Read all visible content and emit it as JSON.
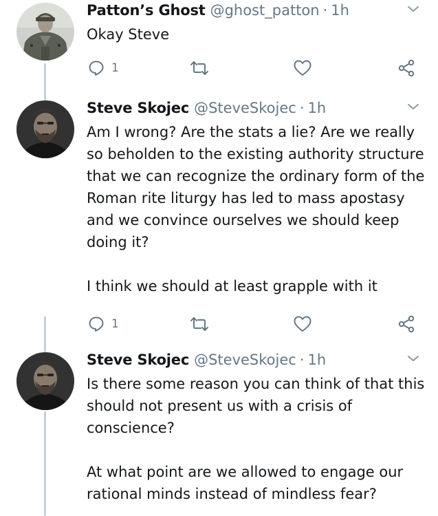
{
  "tweets": [
    {
      "display_name": "Patton’s Ghost",
      "handle": "@ghost_patton",
      "time": "1h",
      "paragraphs": [
        "Okay Steve"
      ],
      "reply_count": "1",
      "avatar_icon": "soldier-photo"
    },
    {
      "display_name": "Steve Skojec",
      "handle": "@SteveSkojec",
      "time": "1h",
      "paragraphs": [
        "Am I wrong? Are the stats a lie? Are we really so beholden to the existing authority structure that we can recognize the ordinary form of the Roman rite liturgy has led to mass apostasy and we convince ourselves we should keep doing it?",
        "I think we should at least grapple with it"
      ],
      "reply_count": "1",
      "avatar_icon": "bearded-man-photo"
    },
    {
      "display_name": "Steve Skojec",
      "handle": "@SteveSkojec",
      "time": "1h",
      "paragraphs": [
        "Is there some reason you can think of that this should not present us with a crisis of conscience?",
        "At what point are we allowed to engage our rational minds instead of mindless fear?"
      ],
      "avatar_icon": "bearded-man-photo"
    }
  ],
  "separator": "·",
  "icons": {
    "reply": "reply-icon",
    "retweet": "retweet-icon",
    "like": "heart-icon",
    "share": "share-icon",
    "more": "chevron-down-icon"
  },
  "colors": {
    "text": "#14171a",
    "secondary": "#657786",
    "thread_line": "#c4cfd6"
  }
}
